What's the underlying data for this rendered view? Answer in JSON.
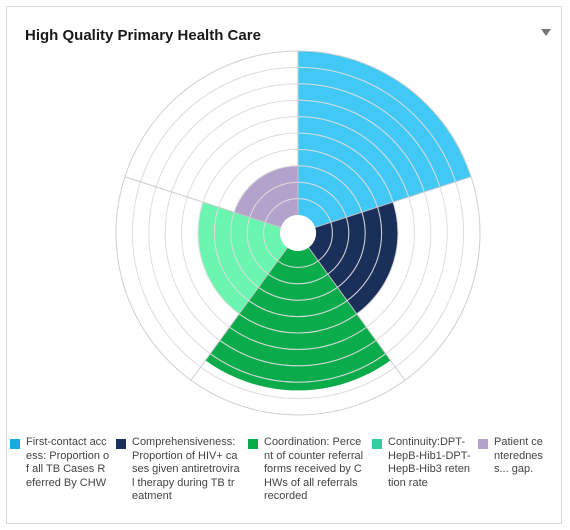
{
  "header": {
    "title": "High Quality Primary Health Care"
  },
  "chart_data": {
    "type": "polar-area",
    "title": "High Quality Primary Health Care",
    "max": 10,
    "categories": [
      "First-contact access: Proportion of all TB Cases Referred By CHW",
      "Comprehensiveness: Proportion of HIV+ cases given antiretroviral therapy during TB treatment",
      "Coordination: Percent of counter referral forms received by CHWs of all referrals recorded",
      "Continuity:DPT-HepB-Hib1-DPT-HepB-Hib3 retention rate",
      "Patient centeredness... gap."
    ],
    "values": [
      10,
      5,
      8.5,
      5,
      3
    ],
    "colors": [
      "#41c8f5",
      "#1a2f5a",
      "#0aab4b",
      "#6af5b0",
      "#b3a2cc"
    ],
    "grid_rings": 10,
    "grid": true,
    "legend_position": "bottom"
  },
  "legend": {
    "items": [
      {
        "label": "First-contact access: Proportion of all TB Cases Referred By CHW",
        "color": "#1ba6e8"
      },
      {
        "label": "Comprehensiveness: Proportion of HIV+ cases given antiretroviral therapy during TB treatment",
        "color": "#1a2f5a"
      },
      {
        "label": "Coordination: Percent of counter referral forms received by CHWs of all referrals recorded",
        "color": "#0aab4b"
      },
      {
        "label": "Continuity:DPT-HepB-Hib1-DPT-HepB-Hib3 retention rate",
        "color": "#2fcf9f"
      },
      {
        "label": "Patient centeredness... gap.",
        "color": "#b3a2cc"
      }
    ]
  }
}
